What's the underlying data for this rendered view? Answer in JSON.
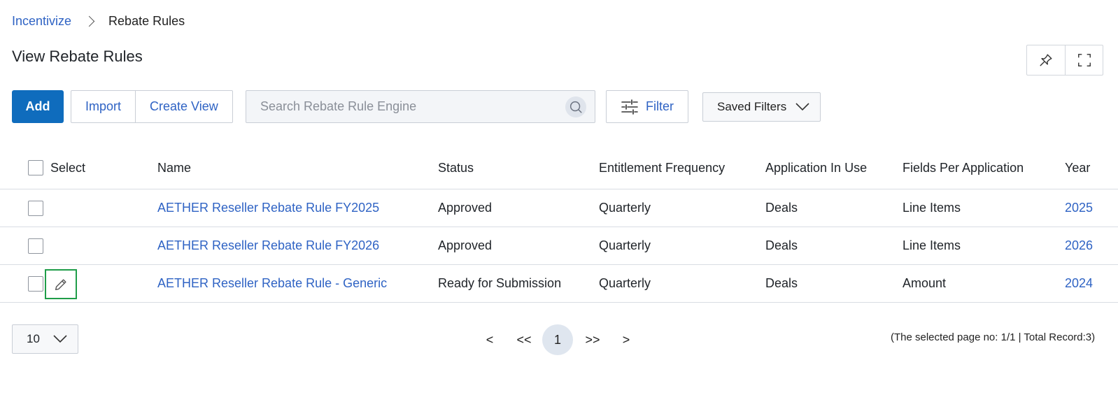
{
  "breadcrumb": {
    "parent": "Incentivize",
    "current": "Rebate Rules"
  },
  "page": {
    "title": "View Rebate Rules"
  },
  "toolbar": {
    "add_label": "Add",
    "import_label": "Import",
    "create_view_label": "Create View",
    "search_placeholder": "Search Rebate Rule Engine",
    "filter_label": "Filter",
    "saved_filters_label": "Saved Filters"
  },
  "table": {
    "columns": {
      "select": "Select",
      "name": "Name",
      "status": "Status",
      "frequency": "Entitlement Frequency",
      "application": "Application In Use",
      "fields": "Fields Per Application",
      "year": "Year"
    },
    "rows": [
      {
        "name": "AETHER Reseller Rebate Rule FY2025",
        "status": "Approved",
        "frequency": "Quarterly",
        "application": "Deals",
        "fields": "Line Items",
        "year": "2025"
      },
      {
        "name": "AETHER Reseller Rebate Rule FY2026",
        "status": "Approved",
        "frequency": "Quarterly",
        "application": "Deals",
        "fields": "Line Items",
        "year": "2026"
      },
      {
        "name": "AETHER Reseller Rebate Rule - Generic",
        "status": "Ready for Submission",
        "frequency": "Quarterly",
        "application": "Deals",
        "fields": "Amount",
        "year": "2024"
      }
    ]
  },
  "pagination": {
    "page_size": "10",
    "prev": "<",
    "first": "<<",
    "current": "1",
    "last": ">>",
    "next": ">",
    "info": "(The selected page no: 1/1 | Total Record:3)"
  },
  "colors": {
    "accent": "#0f6cbd",
    "link": "#2f63c4",
    "highlight": "#1f9d49"
  },
  "icons": [
    "chevron-right-icon",
    "pin-icon",
    "fullscreen-icon",
    "search-icon",
    "sliders-icon",
    "chevron-down-icon",
    "pencil-icon"
  ]
}
